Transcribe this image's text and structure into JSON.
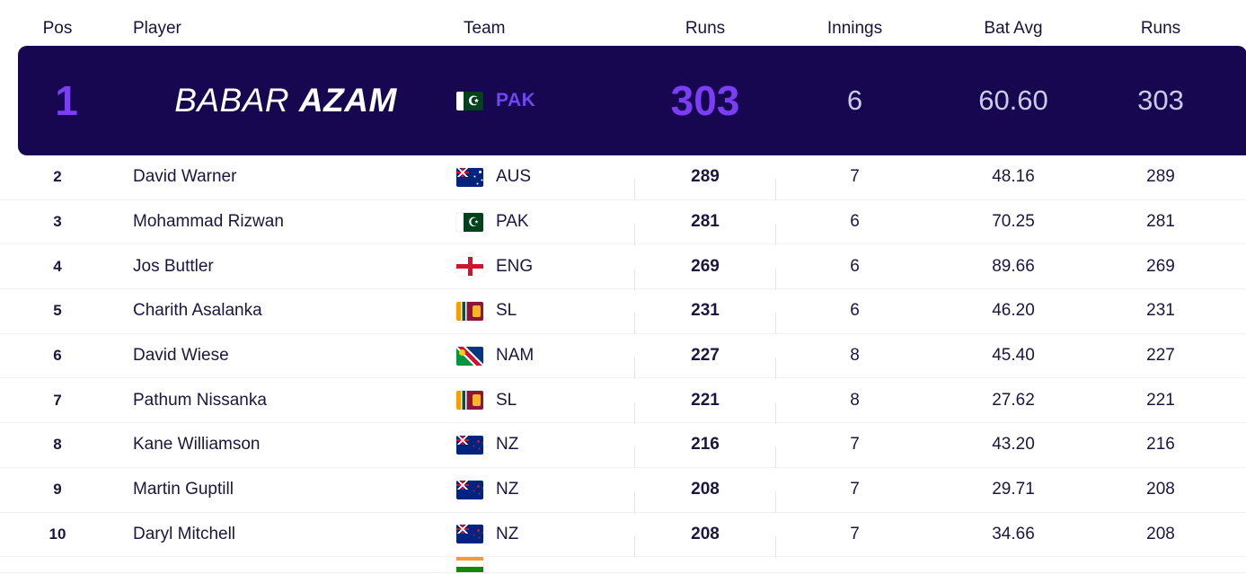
{
  "columns": {
    "pos": "Pos",
    "player": "Player",
    "team": "Team",
    "runs": "Runs",
    "innings": "Innings",
    "bat_avg": "Bat Avg",
    "runs2": "Runs"
  },
  "colors": {
    "feature_bg": "#160750",
    "accent_purple": "#7c3ef5",
    "feature_team": "#6f46ef",
    "feature_muted": "#cfc9e8",
    "text": "#1b1540",
    "row_divider": "#f2f2f5"
  },
  "featured": {
    "pos": "1",
    "first_name": "BABAR",
    "last_name": "AZAM",
    "team": "PAK",
    "flag": "pak-flag",
    "runs": "303",
    "innings": "6",
    "bat_avg": "60.60",
    "runs2": "303"
  },
  "rows": [
    {
      "pos": "2",
      "player": "David Warner",
      "team": "AUS",
      "flag": "aus-flag",
      "runs": "289",
      "innings": "7",
      "bat_avg": "48.16",
      "runs2": "289"
    },
    {
      "pos": "3",
      "player": "Mohammad Rizwan",
      "team": "PAK",
      "flag": "pak-flag",
      "runs": "281",
      "innings": "6",
      "bat_avg": "70.25",
      "runs2": "281"
    },
    {
      "pos": "4",
      "player": "Jos Buttler",
      "team": "ENG",
      "flag": "eng-flag",
      "runs": "269",
      "innings": "6",
      "bat_avg": "89.66",
      "runs2": "269"
    },
    {
      "pos": "5",
      "player": "Charith Asalanka",
      "team": "SL",
      "flag": "sl-flag",
      "runs": "231",
      "innings": "6",
      "bat_avg": "46.20",
      "runs2": "231"
    },
    {
      "pos": "6",
      "player": "David Wiese",
      "team": "NAM",
      "flag": "nam-flag",
      "runs": "227",
      "innings": "8",
      "bat_avg": "45.40",
      "runs2": "227"
    },
    {
      "pos": "7",
      "player": "Pathum Nissanka",
      "team": "SL",
      "flag": "sl-flag",
      "runs": "221",
      "innings": "8",
      "bat_avg": "27.62",
      "runs2": "221"
    },
    {
      "pos": "8",
      "player": "Kane Williamson",
      "team": "NZ",
      "flag": "nz-flag",
      "runs": "216",
      "innings": "7",
      "bat_avg": "43.20",
      "runs2": "216"
    },
    {
      "pos": "9",
      "player": "Martin Guptill",
      "team": "NZ",
      "flag": "nz-flag",
      "runs": "208",
      "innings": "7",
      "bat_avg": "29.71",
      "runs2": "208"
    },
    {
      "pos": "10",
      "player": "Daryl Mitchell",
      "team": "NZ",
      "flag": "nz-flag",
      "runs": "208",
      "innings": "7",
      "bat_avg": "34.66",
      "runs2": "208"
    }
  ],
  "partial_row": {
    "flag": "ind-flag"
  }
}
